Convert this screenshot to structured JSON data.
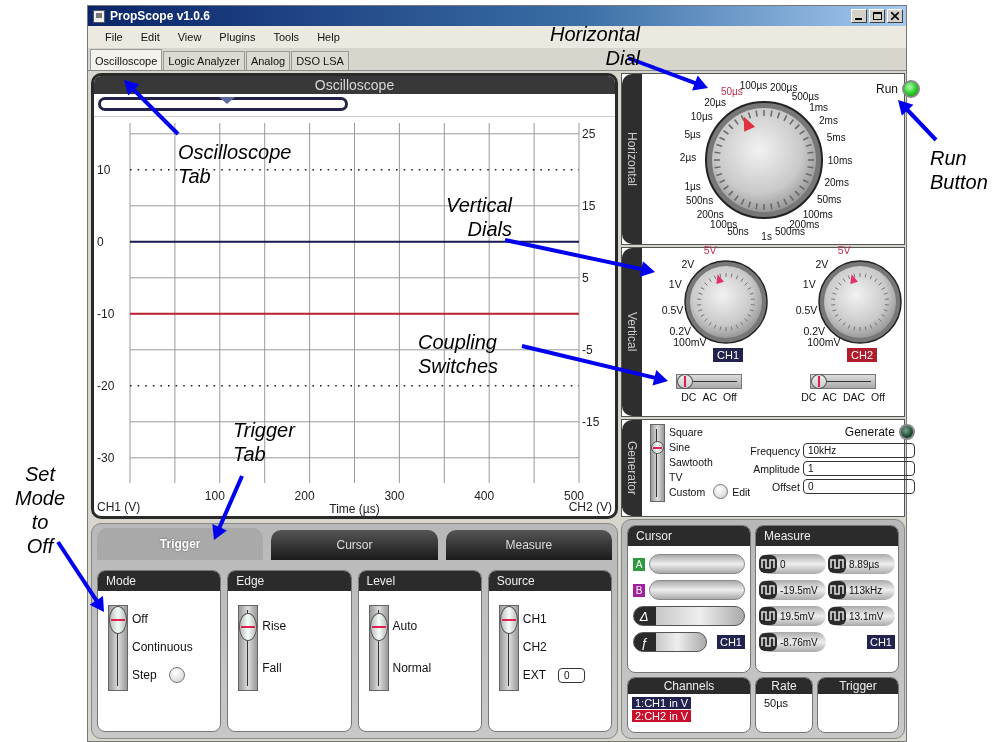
{
  "window": {
    "title": "PropScope v1.0.6"
  },
  "menu": [
    "File",
    "Edit",
    "View",
    "Plugins",
    "Tools",
    "Help"
  ],
  "tabs": [
    {
      "label": "Oscilloscope",
      "selected": true
    },
    {
      "label": "Logic Analyzer",
      "selected": false
    },
    {
      "label": "Analog",
      "selected": false
    },
    {
      "label": "DSO LSA",
      "selected": false
    }
  ],
  "scope": {
    "title": "Oscilloscope",
    "chart_data": {
      "type": "line",
      "xlabel": "Time (µs)",
      "ylabel": "CH1 (V)",
      "y2label": "CH2 (V)",
      "x": [
        0,
        500
      ],
      "xlim": [
        0,
        500
      ],
      "ylim": [
        -33.5,
        16.5
      ],
      "y2lim": [
        -23.5,
        26.5
      ],
      "xticks": [
        100,
        200,
        300,
        400,
        500
      ],
      "yticks": [
        10,
        0,
        -10,
        -20,
        -30
      ],
      "y2ticks": [
        25,
        15,
        5,
        -5,
        -15
      ],
      "series": [
        {
          "color": "#1c1c50",
          "values": [
            0,
            0
          ]
        },
        {
          "color": "#c02030",
          "axis": "y2",
          "values": [
            0,
            0
          ]
        },
        {
          "color": "#222222",
          "line_style": "dotted",
          "values": [
            10,
            10
          ]
        },
        {
          "color": "#222222",
          "line_style": "dotted",
          "values": [
            -20,
            -20
          ]
        }
      ],
      "grid": true
    }
  },
  "horizontal": {
    "title": "Horizontal",
    "run": {
      "label": "Run",
      "on": true
    },
    "timebase_left": [
      {
        "label": "50µs",
        "selected": true
      },
      {
        "label": "20µs",
        "selected": false
      },
      {
        "label": "10µs",
        "selected": false
      },
      {
        "label": "5µs",
        "selected": false
      },
      {
        "label": "2µs",
        "selected": false
      },
      {
        "label": "1µs",
        "selected": false
      },
      {
        "label": "500ns",
        "selected": false
      },
      {
        "label": "200ns",
        "selected": false
      },
      {
        "label": "100ns",
        "selected": false
      },
      {
        "label": "50ns",
        "selected": false
      }
    ],
    "timebase_right": [
      {
        "label": "100µs",
        "selected": false
      },
      {
        "label": "200µs",
        "selected": false
      },
      {
        "label": "500µs",
        "selected": false
      },
      {
        "label": "1ms",
        "selected": false
      },
      {
        "label": "2ms",
        "selected": false
      },
      {
        "label": "5ms",
        "selected": false
      },
      {
        "label": "10ms",
        "selected": false
      },
      {
        "label": "20ms",
        "selected": false
      },
      {
        "label": "50ms",
        "selected": false
      },
      {
        "label": "100ms",
        "selected": false
      },
      {
        "label": "200ms",
        "selected": false
      },
      {
        "label": "500ms",
        "selected": false
      },
      {
        "label": "1s",
        "selected": false
      }
    ]
  },
  "vertical": {
    "title": "Vertical",
    "channels": [
      {
        "name": "CH1",
        "color": "#22224e",
        "scale": [
          {
            "label": "5V",
            "selected": true
          },
          {
            "label": "2V",
            "selected": false
          },
          {
            "label": "1V",
            "selected": false
          },
          {
            "label": "0.5V",
            "selected": false
          },
          {
            "label": "0.2V",
            "selected": false
          },
          {
            "label": "100mV",
            "selected": false
          }
        ],
        "coupling": [
          {
            "label": "DC",
            "selected": true
          },
          {
            "label": "AC",
            "selected": false
          },
          {
            "label": "Off",
            "selected": false
          }
        ]
      },
      {
        "name": "CH2",
        "color": "#b01c2c",
        "scale": [
          {
            "label": "5V",
            "selected": true
          },
          {
            "label": "2V",
            "selected": false
          },
          {
            "label": "1V",
            "selected": false
          },
          {
            "label": "0.5V",
            "selected": false
          },
          {
            "label": "0.2V",
            "selected": false
          },
          {
            "label": "100mV",
            "selected": false
          }
        ],
        "coupling": [
          {
            "label": "DC",
            "selected": true
          },
          {
            "label": "AC",
            "selected": false
          },
          {
            "label": "DAC",
            "selected": false
          },
          {
            "label": "Off",
            "selected": false
          }
        ]
      }
    ]
  },
  "generator": {
    "title": "Generator",
    "generate": {
      "label": "Generate",
      "on": false
    },
    "edit": "Edit",
    "waveforms": [
      {
        "label": "Square",
        "selected": false
      },
      {
        "label": "Sine",
        "selected": true
      },
      {
        "label": "Sawtooth",
        "selected": false
      },
      {
        "label": "TV",
        "selected": false
      },
      {
        "label": "Custom",
        "selected": false
      }
    ],
    "fields": [
      {
        "label": "Frequency",
        "value": "10kHz"
      },
      {
        "label": "Amplitude",
        "value": "1"
      },
      {
        "label": "Offset",
        "value": "0"
      }
    ]
  },
  "bottom_tabs": [
    {
      "label": "Trigger",
      "selected": true
    },
    {
      "label": "Cursor",
      "selected": false
    },
    {
      "label": "Measure",
      "selected": false
    }
  ],
  "trigger": {
    "groups": [
      {
        "title": "Mode",
        "options": [
          {
            "label": "Off",
            "selected": true
          },
          {
            "label": "Continuous",
            "selected": false
          },
          {
            "label": "Step",
            "selected": false
          }
        ],
        "accessory": {
          "kind": "round-button"
        }
      },
      {
        "title": "Edge",
        "options": [
          {
            "label": "Rise",
            "selected": true
          },
          {
            "label": "Fall",
            "selected": false
          }
        ]
      },
      {
        "title": "Level",
        "options": [
          {
            "label": "Auto",
            "selected": true
          },
          {
            "label": "Normal",
            "selected": false
          }
        ]
      },
      {
        "title": "Source",
        "options": [
          {
            "label": "CH1",
            "selected": true
          },
          {
            "label": "CH2",
            "selected": false
          },
          {
            "label": "EXT",
            "selected": false
          }
        ],
        "accessory": {
          "kind": "field",
          "value": "0"
        }
      }
    ]
  },
  "cursor": {
    "title": "Cursor",
    "rows": [
      {
        "kind": "marker",
        "symbol": "A",
        "color": "#2e9a3e"
      },
      {
        "kind": "marker",
        "symbol": "B",
        "color": "#a020a0"
      },
      {
        "kind": "symbol",
        "symbol": "Δ"
      },
      {
        "kind": "symbol",
        "symbol": "ƒ",
        "channel": "CH1"
      }
    ]
  },
  "measure": {
    "title": "Measure",
    "values": [
      "0",
      "8.89µs",
      "-19.5mV",
      "113kHz",
      "19.5mV",
      "13.1mV",
      "-8.76mV"
    ],
    "channel": "CH1"
  },
  "channels": {
    "title": "Channels",
    "items": [
      {
        "label": "1:CH1 in V",
        "color": "#22224e"
      },
      {
        "label": "2:CH2 in V",
        "color": "#c8102e"
      }
    ]
  },
  "rate": {
    "title": "Rate",
    "value": "50µs"
  },
  "trigger_status": {
    "title": "Trigger"
  },
  "callouts": [
    "Horizontal\nDial",
    "Run\nButton",
    "Oscilloscope\nTab",
    "Vertical\nDials",
    "Coupling\nSwitches",
    "Trigger\nTab",
    "Set\nMode\nto\nOff"
  ]
}
